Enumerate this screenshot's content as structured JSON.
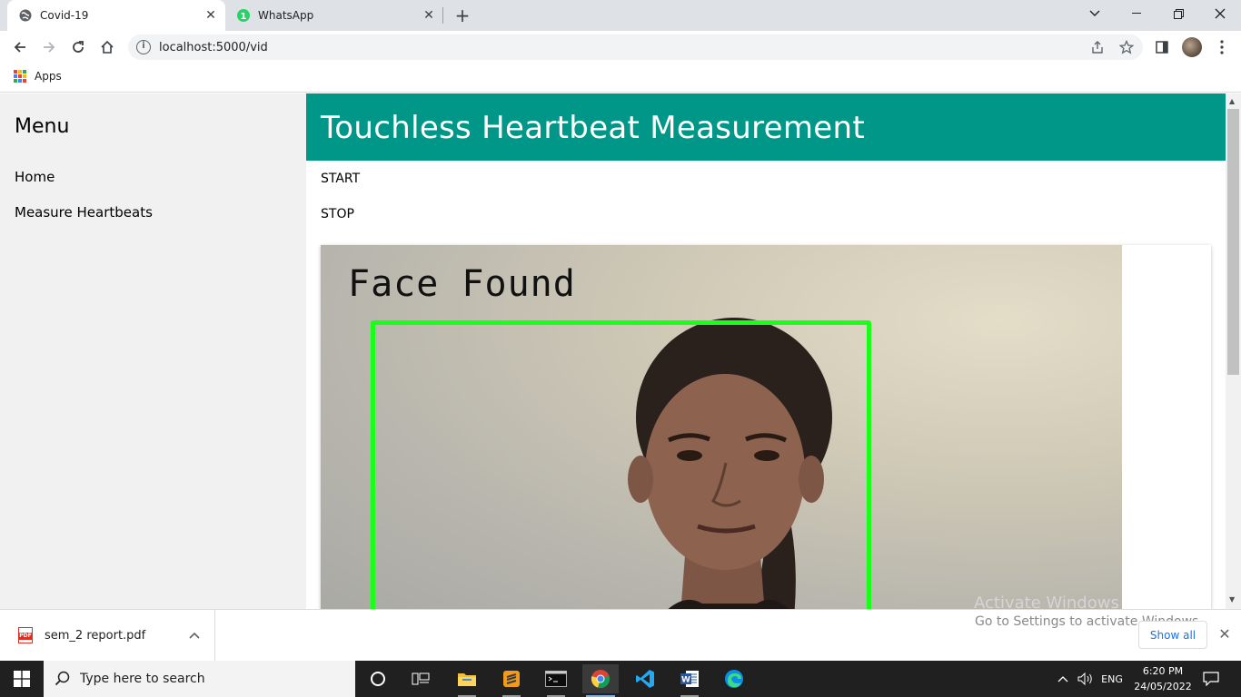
{
  "browser": {
    "tabs": [
      {
        "title": "Covid-19",
        "icon": "globe-icon",
        "active": true
      },
      {
        "title": "WhatsApp",
        "icon": "whatsapp-icon",
        "badge": "1",
        "active": false
      }
    ],
    "url": "localhost:5000/vid",
    "bookmarks": {
      "apps_label": "Apps"
    }
  },
  "sidebar": {
    "title": "Menu",
    "items": [
      {
        "label": "Home"
      },
      {
        "label": "Measure Heartbeats"
      }
    ]
  },
  "header": {
    "title": "Touchless Heartbeat Measurement"
  },
  "controls": {
    "start_label": "START",
    "stop_label": "STOP"
  },
  "video": {
    "overlay_text": "Face Found",
    "box_color": "#19ff19"
  },
  "colors": {
    "header_bg": "#009688",
    "sidebar_bg": "#f1f1f1"
  },
  "downloads": {
    "file_name": "sem_2 report.pdf",
    "file_type_badge": "PDF",
    "show_all_label": "Show all"
  },
  "watermark": {
    "line1": "Activate Windows",
    "line2": "Go to Settings to activate Windows."
  },
  "taskbar": {
    "search_placeholder": "Type here to search",
    "language": "ENG",
    "time": "6:20 PM",
    "date": "24/05/2022"
  }
}
